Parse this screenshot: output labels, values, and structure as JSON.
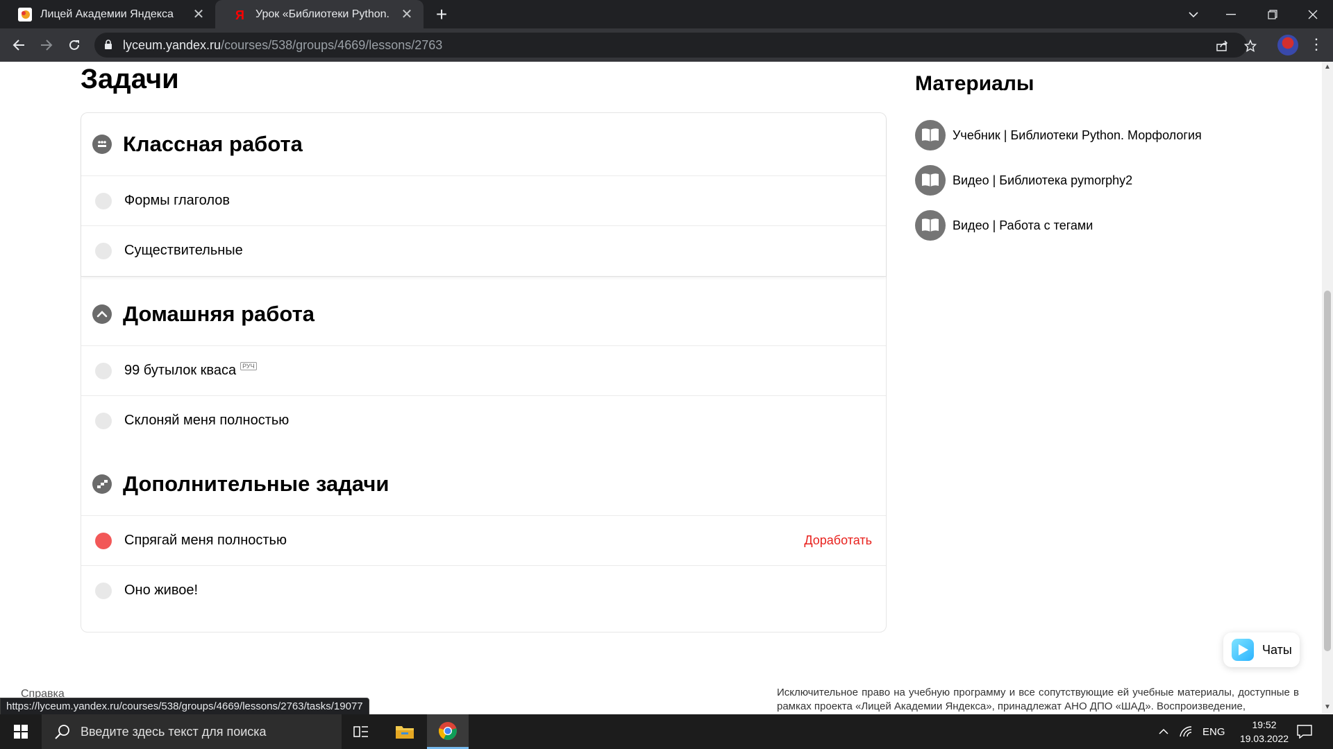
{
  "browser": {
    "tabs": [
      {
        "title": "Лицей Академии Яндекса",
        "favicon_color": "#f0a01e"
      },
      {
        "title": "Урок «Библиотеки Python. Морфология»",
        "favicon_color": "#ff0000"
      }
    ],
    "new_tab_symbol": "+",
    "url_host": "lyceum.yandex.ru",
    "url_path": "/courses/538/groups/4669/lessons/2763",
    "status_url": "https://lyceum.yandex.ru/courses/538/groups/4669/lessons/2763/tasks/19077"
  },
  "page": {
    "tasks_heading": "Задачи",
    "sections": [
      {
        "title": "Классная работа",
        "icon": "classwork-icon",
        "tasks": [
          {
            "label": "Формы глаголов",
            "status": "none"
          },
          {
            "label": "Существительные",
            "status": "none"
          }
        ]
      },
      {
        "title": "Домашняя работа",
        "icon": "homework-icon",
        "tasks": [
          {
            "label": "99 бутылок кваса",
            "tag": "РУЧ",
            "status": "none"
          },
          {
            "label": "Склоняй меня полностью",
            "status": "none"
          }
        ]
      },
      {
        "title": "Дополнительные задачи",
        "icon": "extra-tasks-icon",
        "tasks": [
          {
            "label": "Спрягай меня полностью",
            "status": "rework",
            "action": "Доработать"
          },
          {
            "label": "Оно живое!",
            "status": "none"
          }
        ]
      }
    ],
    "materials_heading": "Материалы",
    "materials": [
      {
        "label": "Учебник | Библиотеки Python. Морфология",
        "icon": "book-icon"
      },
      {
        "label": "Видео | Библиотека pymorphy2",
        "icon": "book-icon"
      },
      {
        "label": "Видео | Работа с тегами",
        "icon": "book-icon"
      }
    ],
    "chat_label": "Чаты",
    "footer_left": "Справка",
    "footer_right": "Исключительное право на учебную программу и все сопутствующие ей учебные материалы, доступные в рамках проекта «Лицей Академии Яндекса», принадлежат АНО ДПО «ШАД». Воспроизведение,"
  },
  "taskbar": {
    "search_placeholder": "Введите здесь текст для поиска",
    "language": "ENG",
    "time": "19:52",
    "date": "19.03.2022"
  },
  "colors": {
    "rework_dot": "#f25858",
    "rework_action": "#e8211d",
    "chrome_dark": "#202124",
    "chrome_toolbar": "#35363a"
  }
}
